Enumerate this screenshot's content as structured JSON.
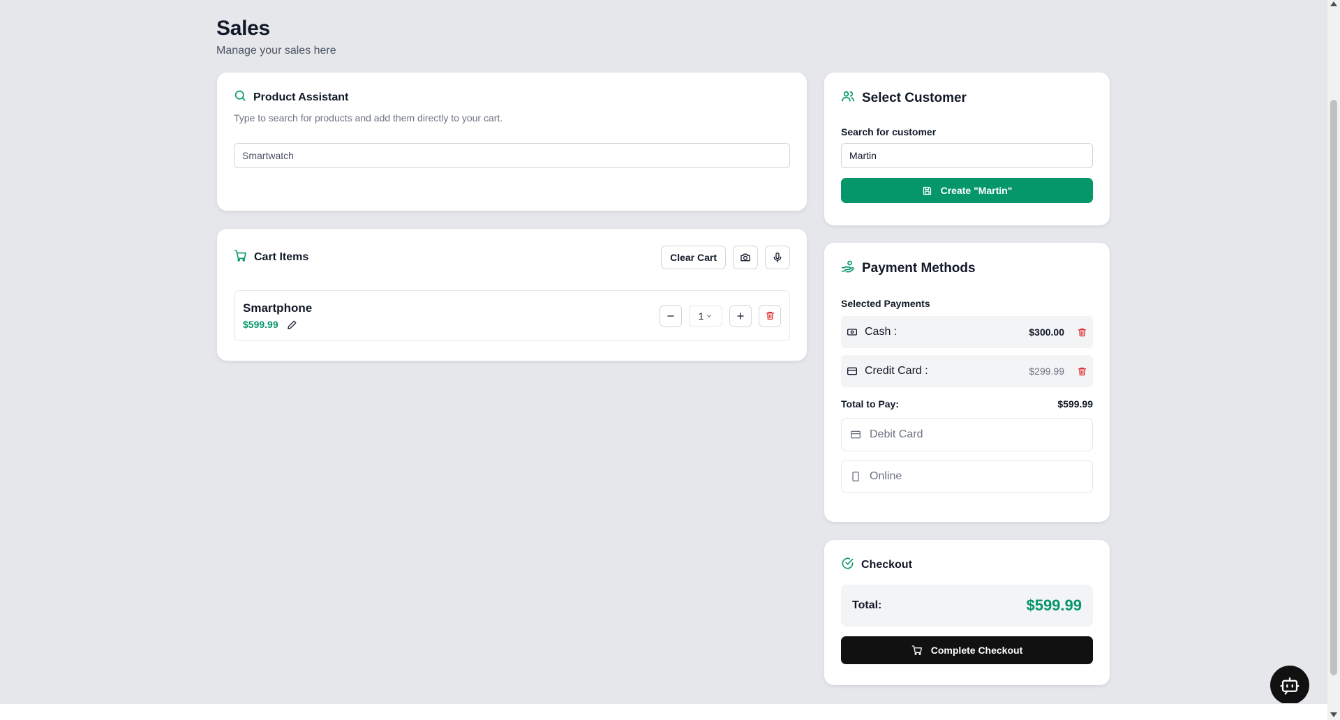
{
  "header": {
    "title": "Sales",
    "subtitle": "Manage your sales here"
  },
  "product_assistant": {
    "title": "Product Assistant",
    "description": "Type to search for products and add them directly to your cart.",
    "search_value": "Smartwatch",
    "icon": "search-icon"
  },
  "cart": {
    "title": "Cart Items",
    "clear_label": "Clear Cart",
    "items": [
      {
        "name": "Smartphone",
        "price": "$599.99",
        "quantity": "1"
      }
    ]
  },
  "customer": {
    "title": "Select Customer",
    "search_label": "Search for customer",
    "search_value": "Martin",
    "create_label": "Create \"Martin\""
  },
  "payment": {
    "title": "Payment Methods",
    "selected_label": "Selected Payments",
    "selected": [
      {
        "label": "Cash :",
        "amount": "$300.00"
      },
      {
        "label": "Credit Card :",
        "amount": "$299.99"
      }
    ],
    "total_label": "Total to Pay:",
    "total_value": "$599.99",
    "methods": [
      {
        "label": "Debit Card"
      },
      {
        "label": "Online"
      }
    ]
  },
  "checkout": {
    "title": "Checkout",
    "total_label": "Total:",
    "total_value": "$599.99",
    "complete_label": "Complete Checkout"
  },
  "colors": {
    "accent": "#059669",
    "danger": "#dc2626",
    "dark": "#111111",
    "background": "#e5e7eb"
  }
}
